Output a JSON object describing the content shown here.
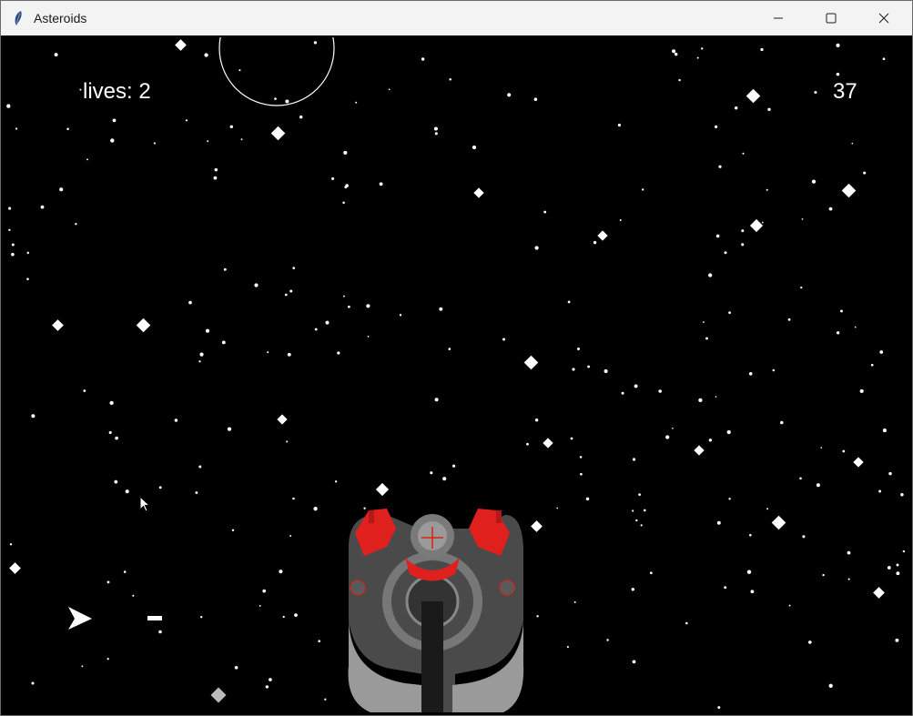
{
  "window": {
    "title": "Asteroids",
    "controls": {
      "minimize": "minimize-icon",
      "maximize": "maximize-icon",
      "close": "close-icon"
    }
  },
  "hud": {
    "lives_text": "lives:  2",
    "lives": 2,
    "score": "37"
  },
  "colors": {
    "background": "#000000",
    "text": "#ffffff",
    "titlebar": "#f3f3f3",
    "enemy_accent": "#e0201c"
  }
}
